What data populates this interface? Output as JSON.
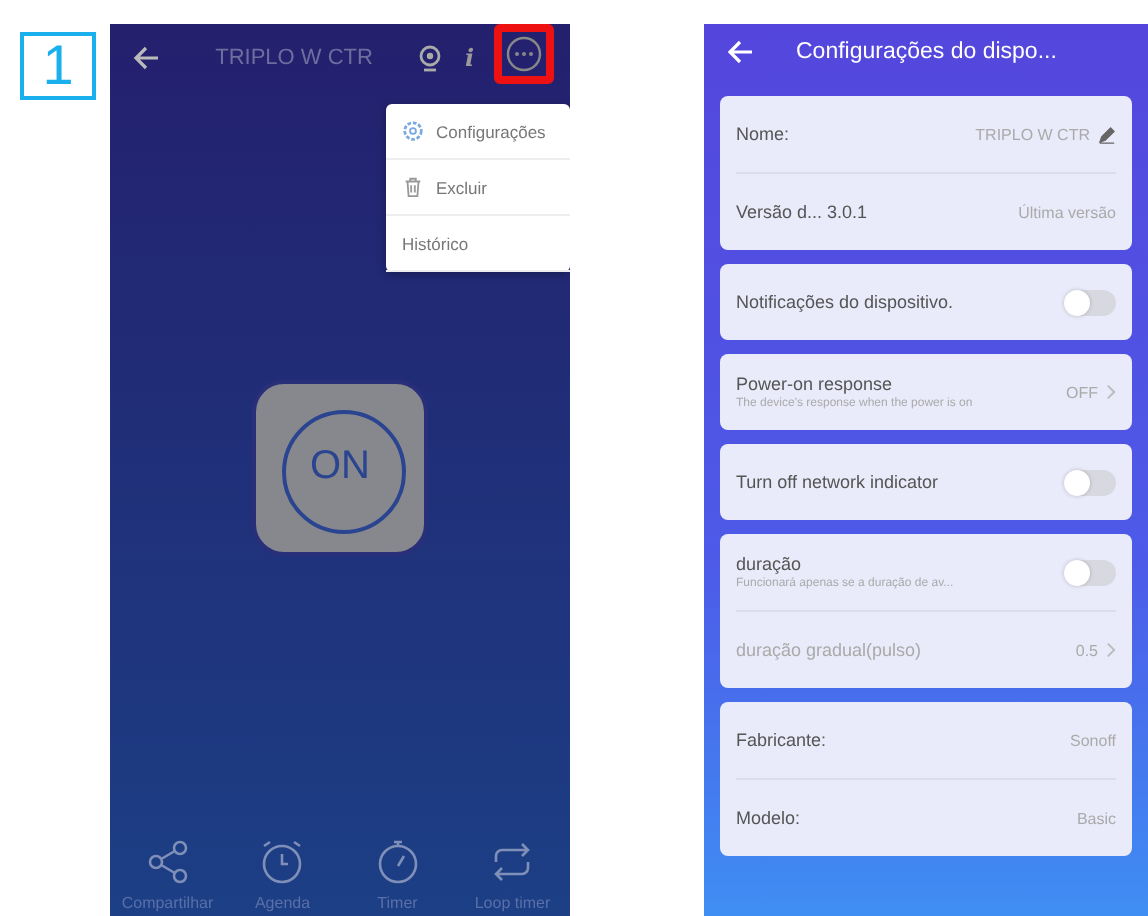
{
  "badge": "1",
  "left_screen": {
    "title": "TRIPLO W CTR",
    "info_glyph": "i",
    "power_label": "ON",
    "menu": [
      {
        "label": "Configurações",
        "kind": "settings"
      },
      {
        "label": "Excluir",
        "kind": "delete"
      },
      {
        "label": "Histórico",
        "kind": "plain"
      }
    ],
    "bottom_bar": [
      {
        "label": "Compartilhar",
        "kind": "share"
      },
      {
        "label": "Agenda",
        "kind": "alarm"
      },
      {
        "label": "Timer",
        "kind": "timer"
      },
      {
        "label": "Loop timer",
        "kind": "loop"
      }
    ]
  },
  "right_screen": {
    "title": "Configurações do dispo...",
    "groups": [
      [
        {
          "kind": "info",
          "label": "Nome:",
          "value": "TRIPLO W CTR",
          "editable": true
        },
        {
          "kind": "info",
          "label": "Versão d... 3.0.1",
          "value": "Última versão",
          "editable": false
        }
      ],
      [
        {
          "kind": "toggle",
          "label": "Notificações do dispositivo.",
          "on": false
        }
      ],
      [
        {
          "kind": "link",
          "label": "Power-on response",
          "subtitle": "The device's response when the power is on",
          "value": "OFF",
          "disabled": false
        }
      ],
      [
        {
          "kind": "toggle",
          "label": "Turn off network indicator",
          "on": false
        }
      ],
      [
        {
          "kind": "toggle",
          "label": "duração",
          "subtitle": "Funcionará apenas se a duração de av...",
          "on": false
        },
        {
          "kind": "link",
          "label": "duração gradual(pulso)",
          "value": "0.5",
          "disabled": true
        }
      ],
      [
        {
          "kind": "info",
          "label": "Fabricante:",
          "value": "Sonoff",
          "editable": false
        },
        {
          "kind": "info",
          "label": "Modelo:",
          "value": "Basic",
          "editable": false
        }
      ]
    ]
  }
}
